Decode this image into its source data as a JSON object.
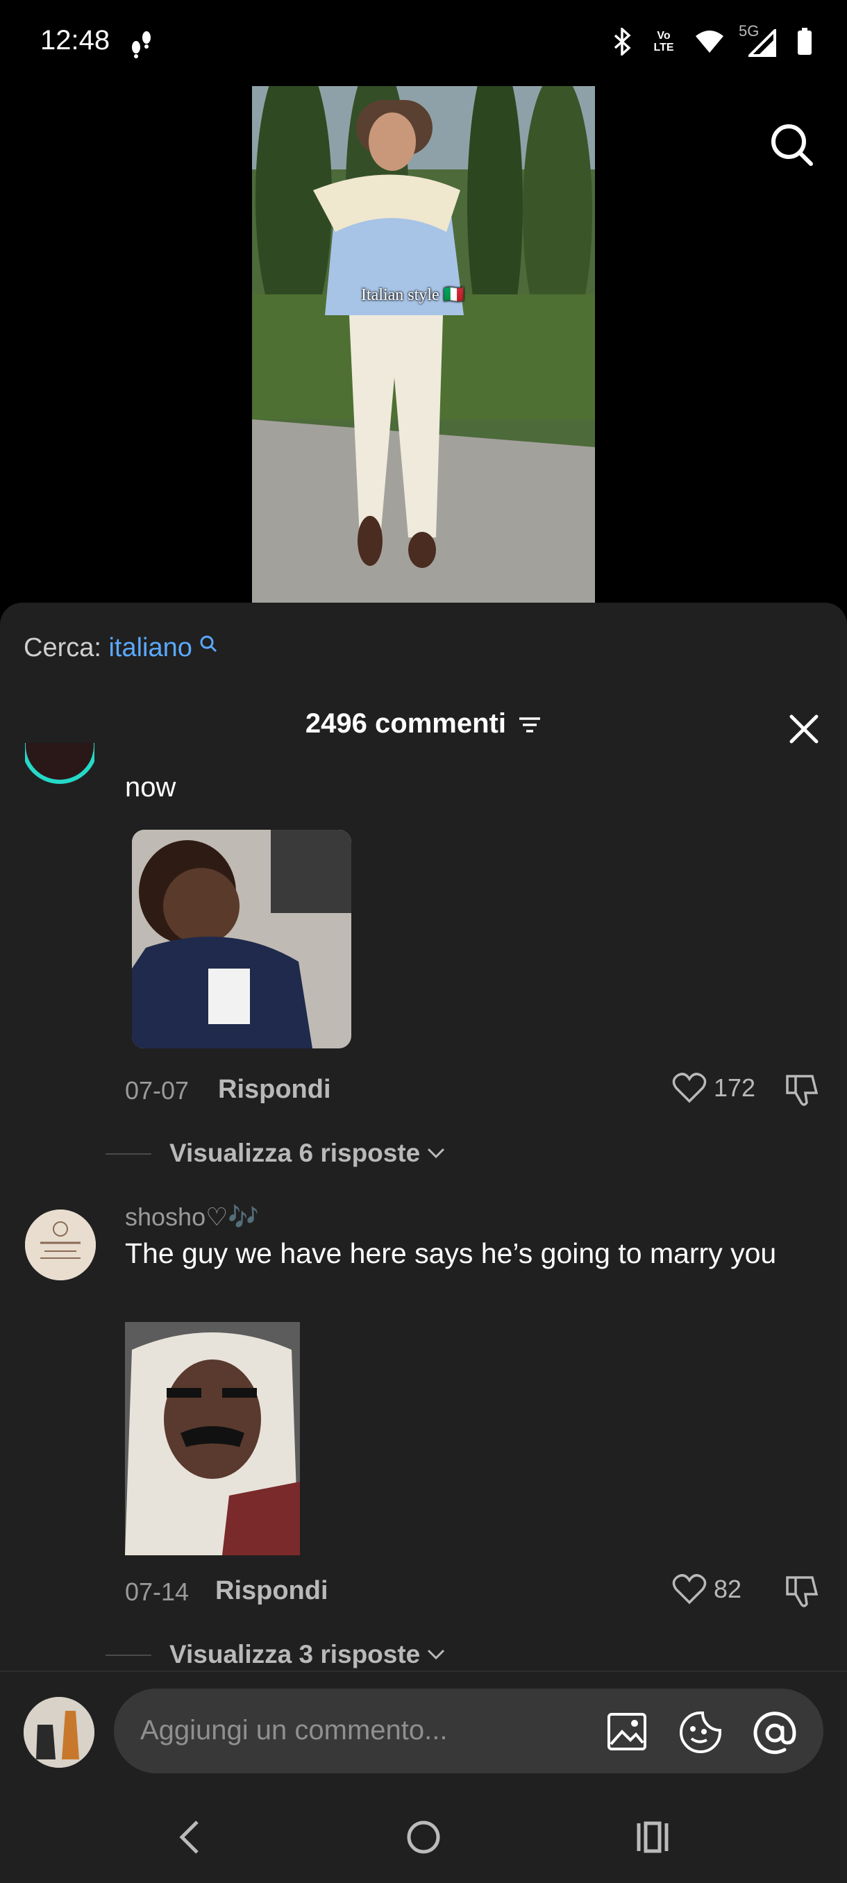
{
  "status_bar": {
    "time": "12:48",
    "network_label": "5G",
    "volte_label": "Vo LTE"
  },
  "video": {
    "caption": "Italian style 🇮🇹"
  },
  "comments": {
    "search_prefix": "Cerca:",
    "search_keyword": "italiano",
    "count_title": "2496 commenti",
    "items": [
      {
        "text": "now",
        "date": "07-07",
        "reply_label": "Rispondi",
        "likes": "172",
        "view_replies": "Visualizza 6 risposte"
      },
      {
        "username": "shosho♡🎶",
        "text": "The guy we have here says he’s going to marry you",
        "date": "07-14",
        "reply_label": "Rispondi",
        "likes": "82",
        "view_replies": "Visualizza 3 risposte"
      }
    ]
  },
  "input": {
    "placeholder": "Aggiungi un commento..."
  },
  "colors": {
    "accent_keyword": "#5aa9ff",
    "panel_bg": "#202020",
    "avatar_ring": "#25d9c8"
  }
}
